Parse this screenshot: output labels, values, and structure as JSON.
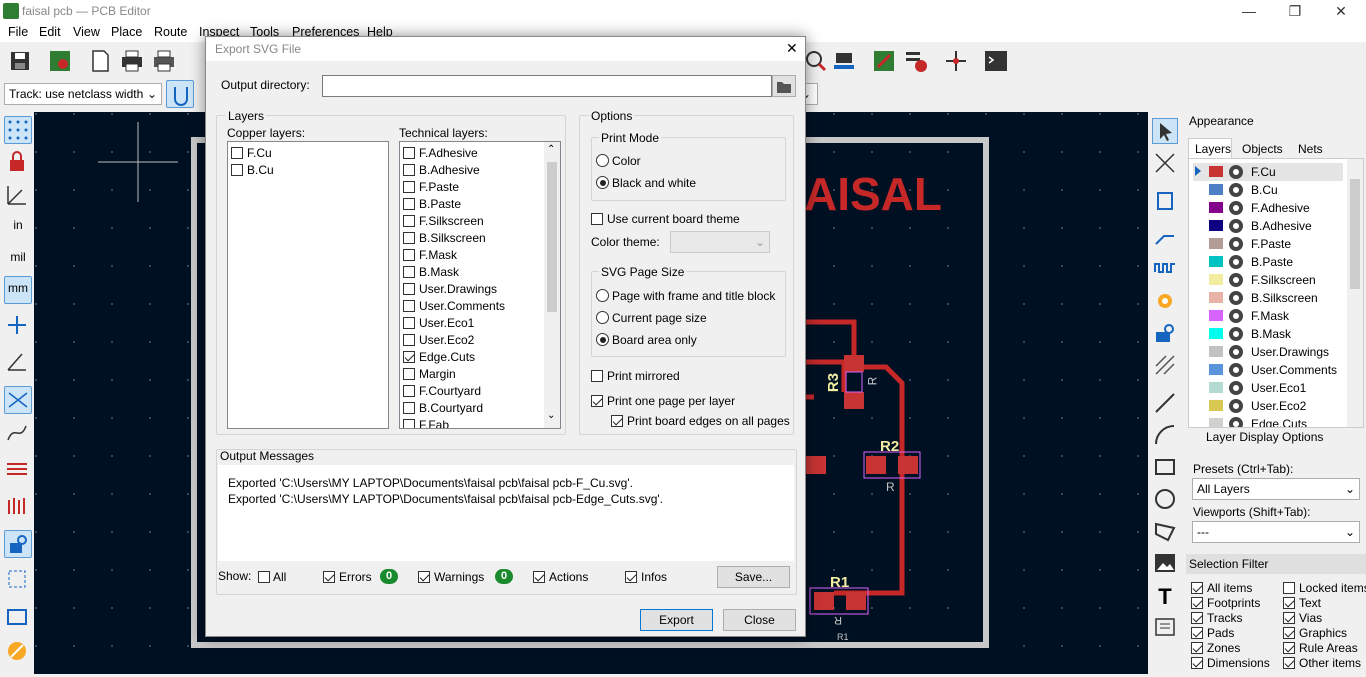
{
  "window": {
    "title": "faisal pcb — PCB Editor",
    "minimize": "—",
    "restore": "❐",
    "close": "✕"
  },
  "menu": [
    "File",
    "Edit",
    "View",
    "Place",
    "Route",
    "Inspect",
    "Tools",
    "Preferences",
    "Help"
  ],
  "toolbar2": {
    "track_width": "Track: use netclass width"
  },
  "canvas": {
    "board_text": "AISAL",
    "refs": {
      "r1": "R1",
      "r2": "R2",
      "r3": "R3",
      "r1_small": "R1",
      "r_a": "R",
      "r_b": "R",
      "r_c": "R"
    }
  },
  "dialog": {
    "title": "Export SVG File",
    "close": "✕",
    "output_dir_label": "Output directory:",
    "output_dir_value": "",
    "layers_group": "Layers",
    "copper_label": "Copper layers:",
    "copper_layers": [
      {
        "name": "F.Cu",
        "checked": false
      },
      {
        "name": "B.Cu",
        "checked": false
      }
    ],
    "technical_label": "Technical layers:",
    "technical_layers": [
      {
        "name": "F.Adhesive",
        "checked": false
      },
      {
        "name": "B.Adhesive",
        "checked": false
      },
      {
        "name": "F.Paste",
        "checked": false
      },
      {
        "name": "B.Paste",
        "checked": false
      },
      {
        "name": "F.Silkscreen",
        "checked": false
      },
      {
        "name": "B.Silkscreen",
        "checked": false
      },
      {
        "name": "F.Mask",
        "checked": false
      },
      {
        "name": "B.Mask",
        "checked": false
      },
      {
        "name": "User.Drawings",
        "checked": false
      },
      {
        "name": "User.Comments",
        "checked": false
      },
      {
        "name": "User.Eco1",
        "checked": false
      },
      {
        "name": "User.Eco2",
        "checked": false
      },
      {
        "name": "Edge.Cuts",
        "checked": true
      },
      {
        "name": "Margin",
        "checked": false
      },
      {
        "name": "F.Courtyard",
        "checked": false
      },
      {
        "name": "B.Courtyard",
        "checked": false
      },
      {
        "name": "F.Fab",
        "checked": false
      }
    ],
    "options_group": "Options",
    "print_mode": {
      "label": "Print Mode",
      "color": "Color",
      "bw": "Black and white",
      "selected": "bw"
    },
    "use_theme": "Use current board theme",
    "color_theme_label": "Color theme:",
    "color_theme_value": "",
    "page_size": {
      "label": "SVG Page Size",
      "frame": "Page with frame and title block",
      "current": "Current page size",
      "board": "Board area only",
      "selected": "board"
    },
    "print_mirrored": "Print mirrored",
    "one_page": "Print one page per layer",
    "board_edges": "Print board edges on all pages",
    "messages_label": "Output Messages",
    "messages": [
      "Exported 'C:\\Users\\MY LAPTOP\\Documents\\faisal pcb\\faisal pcb-F_Cu.svg'.",
      "Exported 'C:\\Users\\MY LAPTOP\\Documents\\faisal pcb\\faisal pcb-Edge_Cuts.svg'."
    ],
    "show_label": "Show:",
    "filters": {
      "all": "All",
      "errors": "Errors",
      "errors_count": "0",
      "warnings": "Warnings",
      "warnings_count": "0",
      "actions": "Actions",
      "infos": "Infos"
    },
    "save_button": "Save...",
    "export_button": "Export",
    "close_button": "Close"
  },
  "appearance": {
    "title": "Appearance",
    "tabs": [
      "Layers",
      "Objects",
      "Nets"
    ],
    "layers": [
      {
        "name": "F.Cu",
        "color": "#c83434"
      },
      {
        "name": "B.Cu",
        "color": "#4d7fc4"
      },
      {
        "name": "F.Adhesive",
        "color": "#84008a"
      },
      {
        "name": "B.Adhesive",
        "color": "#0f0082"
      },
      {
        "name": "F.Paste",
        "color": "#b49c96"
      },
      {
        "name": "B.Paste",
        "color": "#00c2c2"
      },
      {
        "name": "F.Silkscreen",
        "color": "#f2eda1"
      },
      {
        "name": "B.Silkscreen",
        "color": "#e8b2a7"
      },
      {
        "name": "F.Mask",
        "color": "#d864ff"
      },
      {
        "name": "B.Mask",
        "color": "#02ffee"
      },
      {
        "name": "User.Drawings",
        "color": "#c2c2c2"
      },
      {
        "name": "User.Comments",
        "color": "#5994dc"
      },
      {
        "name": "User.Eco1",
        "color": "#b4dbd2"
      },
      {
        "name": "User.Eco2",
        "color": "#d8c852"
      },
      {
        "name": "Edge.Cuts",
        "color": "#d0d2cd"
      }
    ],
    "layer_display_options": "Layer Display Options",
    "presets_label": "Presets (Ctrl+Tab):",
    "presets_value": "All Layers",
    "viewports_label": "Viewports (Shift+Tab):",
    "viewports_value": "---",
    "selection_filter": "Selection Filter",
    "filters_left": [
      "All items",
      "Footprints",
      "Tracks",
      "Pads",
      "Zones",
      "Dimensions"
    ],
    "filters_right": [
      "Locked items",
      "Text",
      "Vias",
      "Graphics",
      "Rule Areas",
      "Other items"
    ]
  }
}
